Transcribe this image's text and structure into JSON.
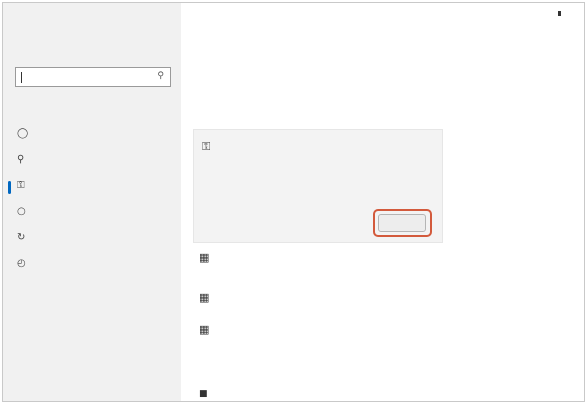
{
  "window": {
    "title": ""
  },
  "nav": {
    "home_label": "",
    "search_placeholder": "",
    "section_label": "",
    "items": [
      {
        "label": "",
        "icon": "shield-icon"
      },
      {
        "label": "",
        "icon": "key-icon"
      },
      {
        "label": "",
        "icon": "sign-in-options-icon"
      },
      {
        "label": "",
        "icon": "user-account-icon"
      },
      {
        "label": "",
        "icon": "sync-icon"
      },
      {
        "label": "",
        "icon": "clock-icon"
      }
    ],
    "selected_index": 2
  },
  "main": {
    "page_title": "",
    "intro_text": "",
    "intro_value": "",
    "section_text": "",
    "card": {
      "title": "",
      "subtitle": "",
      "description": "",
      "link_label": "",
      "button_label": ""
    },
    "options": [
      {
        "title": "",
        "subtitle": "",
        "icon": "option-icon"
      },
      {
        "title": "",
        "subtitle": "",
        "icon": "option-icon"
      },
      {
        "title": "",
        "subtitle": "",
        "icon": "option-icon"
      }
    ],
    "footer": {
      "heading": "",
      "link_label": ""
    }
  },
  "colors": {
    "accent": "#0067c0",
    "focus_ring": "#d35a3c",
    "nav_background": "#f1f1f1"
  }
}
